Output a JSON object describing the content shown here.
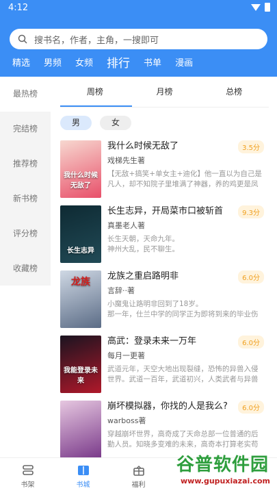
{
  "status": {
    "time": "4:12"
  },
  "search": {
    "placeholder": "搜书名，作者，主角，一搜即可"
  },
  "top_tabs": [
    "精选",
    "男频",
    "女频",
    "排行",
    "书单",
    "漫画"
  ],
  "side": [
    "最热榜",
    "完结榜",
    "推荐榜",
    "新书榜",
    "评分榜",
    "收藏榜"
  ],
  "sub_tabs": [
    "周榜",
    "月榜",
    "总榜"
  ],
  "gender": [
    "男",
    "女"
  ],
  "books": [
    {
      "title": "我什么时候无敌了",
      "score": "3.5分",
      "author": "戏梯先生著",
      "desc": "【无敌+搞笑+单女主+迪化】他一直以为自己是凡人，却不知院子里堆满了神器，养的鸡更是凤凰!...",
      "cover_text": "我什么时候无敌了",
      "cover_colors": [
        "#f7d8d0",
        "#e8506a"
      ]
    },
    {
      "title": "长生志异，开局菜市口被斩首",
      "score": "9.3分",
      "author": "真墨老人著",
      "desc": "长生天朝，天命九年。\n    神州大乱，民不聊生。",
      "cover_text": "长生志异",
      "cover_colors": [
        "#0e2a33",
        "#214a56"
      ]
    },
    {
      "title": "龙族之重启路明非",
      "score": "6.0分",
      "author": "言辞··著",
      "desc": "小魔鬼让路明非回到了18岁。\n那一年，仕兰中学的同学正为即将到来的毕业伤感...",
      "cover_text": "龙族",
      "cover_colors": [
        "#cfd8e4",
        "#5b6c86"
      ]
    },
    {
      "title": "高武：登录未来一万年",
      "score": "6.0分",
      "author": "每月一更著",
      "desc": "武道元年，天空大地出现裂缝，恐怖的异兽入侵世界。武道一百年，武道初兴，人类武者与异兽争锋...",
      "cover_text": "我能登录未来",
      "cover_colors": [
        "#1a1420",
        "#b0182a"
      ]
    },
    {
      "title": "崩坏模拟器，你找的人是我么?",
      "score": "6.0分",
      "author": "warboss著",
      "desc": "穿越崩坏世界，高奇成了天命总部一位普通的后勤人员。知晓多变难的未来，高奇本打算老实苟到...",
      "cover_text": "",
      "cover_colors": [
        "#e6c7e0",
        "#7a3a8a"
      ]
    }
  ],
  "bottom_nav": [
    "书架",
    "书城",
    "福利",
    "",
    ""
  ],
  "watermark": {
    "title": "谷普软件园",
    "url": "www.gupuxiazai.com"
  },
  "colors": {
    "brand": "#3b8ef5",
    "score_text": "#f0a020",
    "score_bg": "#fff3dc"
  }
}
